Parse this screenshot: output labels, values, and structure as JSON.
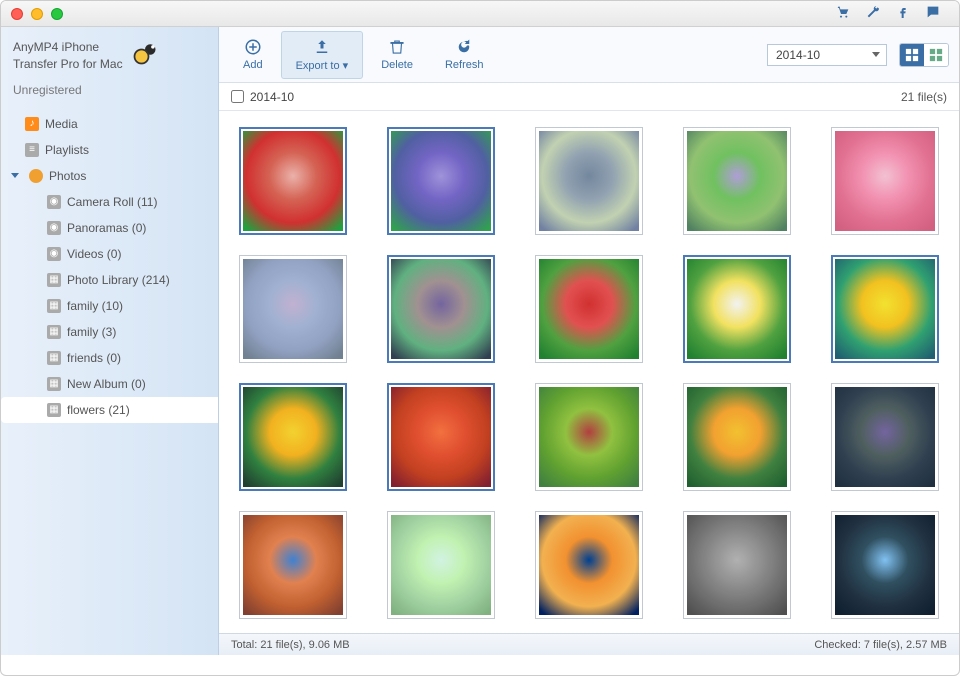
{
  "app": {
    "title_line1": "AnyMP4 iPhone",
    "title_line2": "Transfer Pro for Mac",
    "status": "Unregistered"
  },
  "header_icons": [
    "cart-icon",
    "wrench-icon",
    "facebook-icon",
    "comment-icon"
  ],
  "sidebar": {
    "items": [
      {
        "icon": "music",
        "label": "Media",
        "level": 1
      },
      {
        "icon": "playlist",
        "label": "Playlists",
        "level": 1
      },
      {
        "icon": "photo",
        "label": "Photos",
        "level": 1,
        "expanded": true
      },
      {
        "icon": "camera",
        "label": "Camera Roll (11)",
        "level": 2
      },
      {
        "icon": "camera",
        "label": "Panoramas (0)",
        "level": 2
      },
      {
        "icon": "camera",
        "label": "Videos (0)",
        "level": 2
      },
      {
        "icon": "img",
        "label": "Photo Library (214)",
        "level": 2
      },
      {
        "icon": "img",
        "label": "family (10)",
        "level": 2
      },
      {
        "icon": "img",
        "label": "family (3)",
        "level": 2
      },
      {
        "icon": "img",
        "label": "friends (0)",
        "level": 2
      },
      {
        "icon": "img",
        "label": "New Album (0)",
        "level": 2
      },
      {
        "icon": "img",
        "label": "flowers (21)",
        "level": 2,
        "selected": true
      }
    ]
  },
  "toolbar": {
    "add_label": "Add",
    "export_label": "Export to ▾",
    "delete_label": "Delete",
    "refresh_label": "Refresh",
    "select_value": "2014-10"
  },
  "breadcrumb": {
    "folder": "2014-10",
    "count_text": "21 file(s)"
  },
  "thumbs": [
    {
      "sel": true,
      "g": "rose"
    },
    {
      "sel": true,
      "g": "violet"
    },
    {
      "sel": false,
      "g": "blur1"
    },
    {
      "sel": false,
      "g": "lav"
    },
    {
      "sel": false,
      "g": "pink"
    },
    {
      "sel": false,
      "g": "branches"
    },
    {
      "sel": true,
      "g": "lotus"
    },
    {
      "sel": false,
      "g": "poppy"
    },
    {
      "sel": true,
      "g": "daisy"
    },
    {
      "sel": true,
      "g": "dand"
    },
    {
      "sel": true,
      "g": "yellow"
    },
    {
      "sel": true,
      "g": "orange"
    },
    {
      "sel": false,
      "g": "field"
    },
    {
      "sel": false,
      "g": "tulip"
    },
    {
      "sel": false,
      "g": "lotus2"
    },
    {
      "sel": false,
      "g": "desert"
    },
    {
      "sel": false,
      "g": "hydra"
    },
    {
      "sel": false,
      "g": "jelly"
    },
    {
      "sel": false,
      "g": "koala"
    },
    {
      "sel": false,
      "g": "light"
    }
  ],
  "status": {
    "left": "Total: 21 file(s), 9.06 MB",
    "right": "Checked: 7 file(s), 2.57 MB"
  },
  "swatches": {
    "rose": [
      "#f8bcb4",
      "#e06a5a",
      "#d33",
      "#2a4"
    ],
    "violet": [
      "#a89be6",
      "#7a6bd0",
      "#56a",
      "#3a5"
    ],
    "blur1": [
      "#7a8fa6",
      "#9ab",
      "#cdb",
      "#78a"
    ],
    "lav": [
      "#b9a6e3",
      "#7c6",
      "#9c7",
      "#586"
    ],
    "pink": [
      "#fcd",
      "#f9b",
      "#e79",
      "#d68"
    ],
    "branches": [
      "#cbd",
      "#abd",
      "#9ac",
      "#789"
    ],
    "lotus": [
      "#7a6aa8",
      "#a99",
      "#6b8",
      "#345"
    ],
    "poppy": [
      "#d33",
      "#e55",
      "#5a4",
      "#283"
    ],
    "daisy": [
      "#fff",
      "#fe6",
      "#5a4",
      "#283"
    ],
    "dand": [
      "#fe3",
      "#fc2",
      "#3a7",
      "#267"
    ],
    "yellow": [
      "#fd3",
      "#fb2",
      "#384",
      "#243"
    ],
    "orange": [
      "#f74",
      "#e53",
      "#c42",
      "#823"
    ],
    "field": [
      "#b44",
      "#9c4",
      "#6a3",
      "#484"
    ],
    "tulip": [
      "#fc3",
      "#fa3",
      "#484",
      "#263"
    ],
    "lotus2": [
      "#7a6aa8",
      "#566",
      "#345",
      "#234"
    ],
    "desert": [
      "#48d",
      "#e85",
      "#c63",
      "#843"
    ],
    "hydra": [
      "#dfe",
      "#cfb",
      "#ada",
      "#8b8"
    ],
    "jelly": [
      "#049",
      "#f93",
      "#fb5",
      "#026"
    ],
    "koala": [
      "#bbb",
      "#999",
      "#777",
      "#555"
    ],
    "light": [
      "#8cf",
      "#356",
      "#234",
      "#123"
    ]
  }
}
